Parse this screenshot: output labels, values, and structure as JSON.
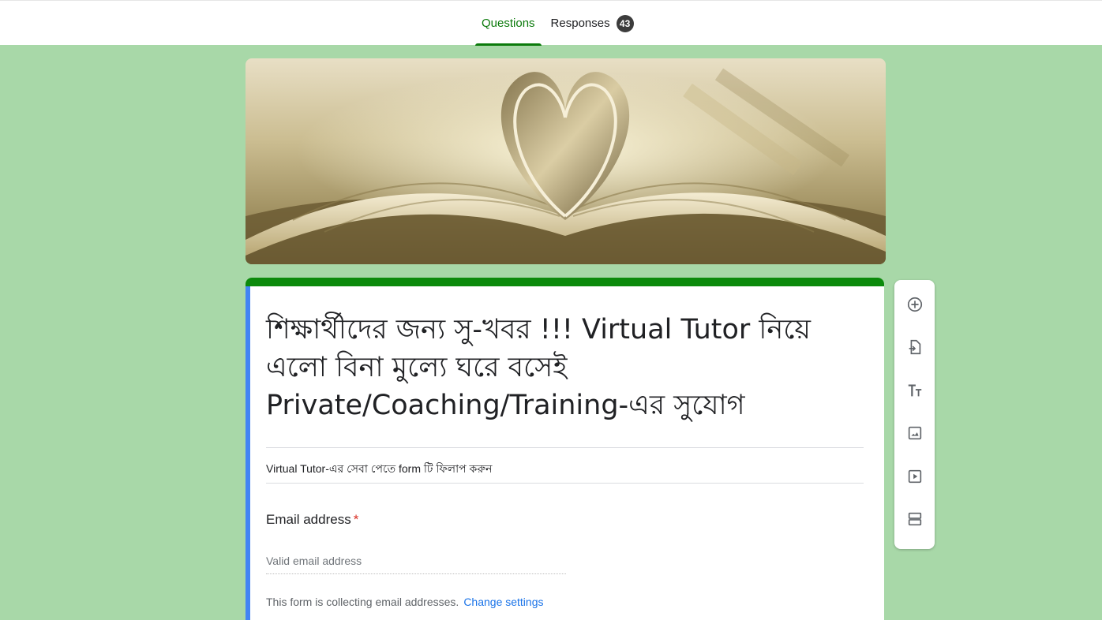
{
  "tabs": [
    {
      "label": "Questions",
      "active": true
    },
    {
      "label": "Responses",
      "badge": "43"
    }
  ],
  "banner": {
    "image": "open-book-heart-pages"
  },
  "form": {
    "title": "শিক্ষার্থীদের জন্য সু-খবর !!! Virtual Tutor নিয়ে এলো বিনা মুল্যে ঘরে বসেই Private/Coaching/Training-এর সুযোগ",
    "description": "Virtual Tutor-এর সেবা পেতে form টি ফিলাপ করুন",
    "email_label": "Email address",
    "required_mark": "*",
    "email_placeholder": "Valid email address",
    "collecting_note": "This form is collecting email addresses.",
    "change_settings": "Change settings"
  },
  "toolbar": {
    "icons": [
      "add-question-icon",
      "import-questions-icon",
      "add-title-icon",
      "add-image-icon",
      "add-video-icon",
      "add-section-icon"
    ]
  },
  "colors": {
    "background": "#a8d8a8",
    "accent": "#0c8a0c",
    "focus": "#4285f4",
    "link": "#1a73e8"
  }
}
